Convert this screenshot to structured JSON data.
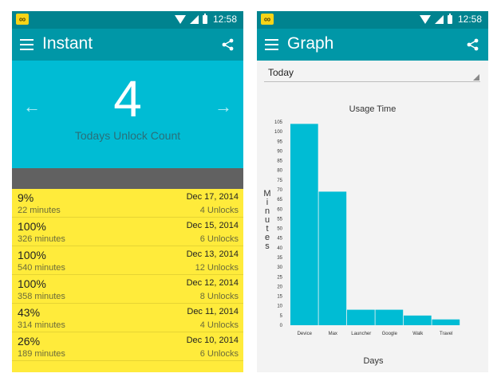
{
  "status": {
    "time": "12:58"
  },
  "left": {
    "title": "Instant",
    "count": "4",
    "arrow_left": "←",
    "arrow_right": "→",
    "count_label": "Todays Unlock Count",
    "rows": [
      {
        "percent": "9%",
        "minutes": "22 minutes",
        "date": "Dec 17, 2014",
        "unlocks": "4 Unlocks"
      },
      {
        "percent": "100%",
        "minutes": "326 minutes",
        "date": "Dec 15, 2014",
        "unlocks": "6 Unlocks"
      },
      {
        "percent": "100%",
        "minutes": "540 minutes",
        "date": "Dec 13, 2014",
        "unlocks": "12 Unlocks"
      },
      {
        "percent": "100%",
        "minutes": "358 minutes",
        "date": "Dec 12, 2014",
        "unlocks": "8 Unlocks"
      },
      {
        "percent": "43%",
        "minutes": "314 minutes",
        "date": "Dec 11, 2014",
        "unlocks": "4 Unlocks"
      },
      {
        "percent": "26%",
        "minutes": "189 minutes",
        "date": "Dec 10, 2014",
        "unlocks": "6 Unlocks"
      }
    ]
  },
  "right": {
    "title": "Graph",
    "dropdown": "Today"
  },
  "colors": {
    "statusbar": "#00838f",
    "appbar": "#0097a7",
    "hero": "#00bcd4",
    "bar": "#00bcd4",
    "list": "#ffeb3b"
  },
  "icons": [
    "menu-icon",
    "share-icon",
    "arrow-left-icon",
    "arrow-right-icon",
    "infinity-icon",
    "wifi-icon",
    "signal-icon",
    "battery-icon",
    "dropdown-caret-icon"
  ],
  "chart_data": {
    "type": "bar",
    "title": "Usage Time",
    "xlabel": "Days",
    "ylabel": "Minutes",
    "categories": [
      "Device",
      "Max",
      "Launcher",
      "Google",
      "Walk",
      "Travel"
    ],
    "values": [
      104,
      69,
      8,
      8,
      5,
      3
    ],
    "ylim": [
      0,
      105
    ],
    "yticks": [
      0,
      5,
      10,
      15,
      20,
      25,
      30,
      35,
      40,
      45,
      50,
      55,
      60,
      65,
      70,
      75,
      80,
      85,
      90,
      95,
      100,
      105
    ],
    "grid": false
  }
}
